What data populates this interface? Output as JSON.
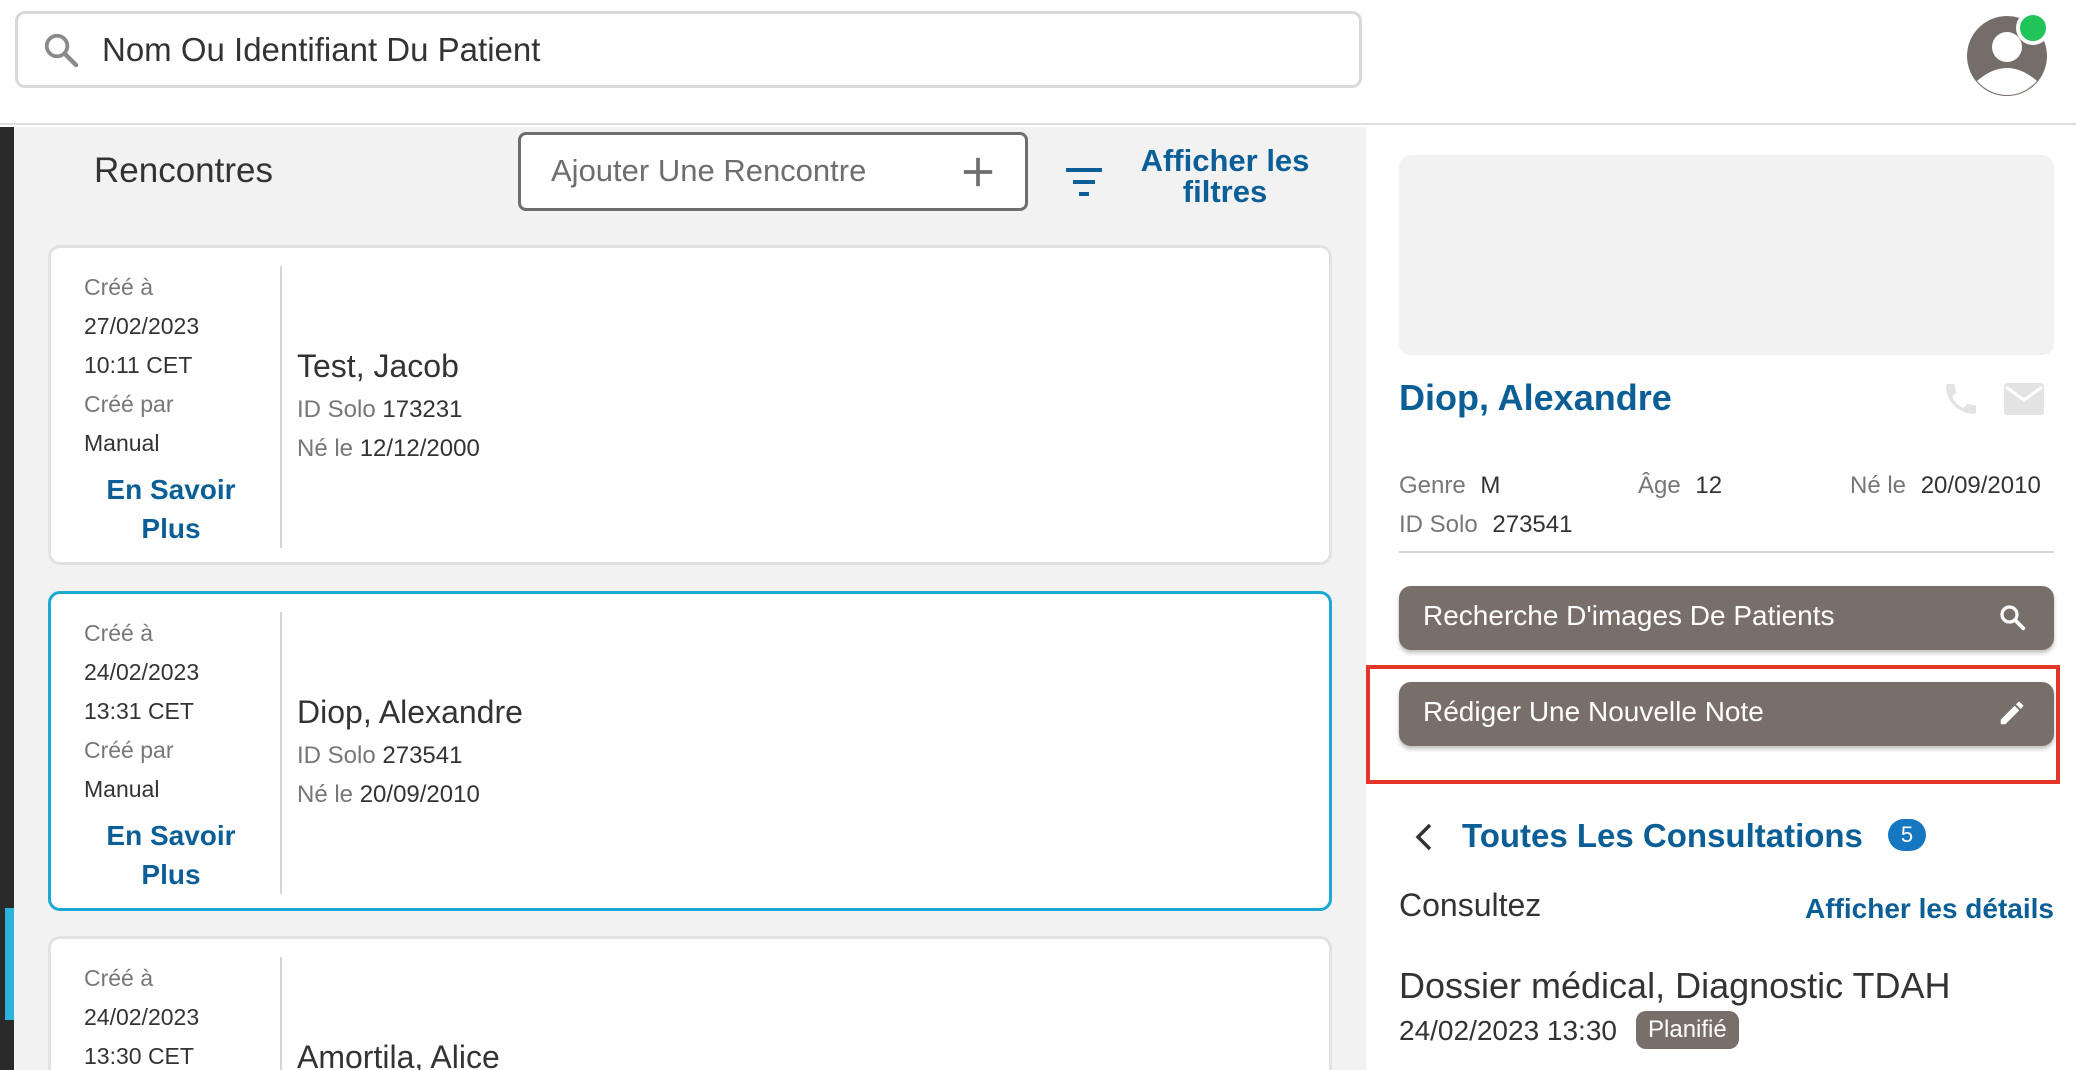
{
  "search": {
    "placeholder": "Nom Ou Identifiant Du Patient"
  },
  "user": {
    "avatar_icon": "user-avatar-icon",
    "status_color": "#21c45a"
  },
  "encounters": {
    "title": "Rencontres",
    "add_label": "Ajouter Une Rencontre",
    "filters_line1": "Afficher les",
    "filters_line2": "filtres",
    "list": [
      {
        "created_at_label": "Créé à",
        "date": "27/02/2023",
        "time": "10:11 CET",
        "created_by_label": "Créé par",
        "created_by": "Manual",
        "more_line1": "En Savoir",
        "more_line2": "Plus",
        "patient_name": "Test, Jacob",
        "id_label": "ID Solo",
        "id": "173231",
        "dob_label": "Né le",
        "dob": "12/12/2000",
        "selected": false
      },
      {
        "created_at_label": "Créé à",
        "date": "24/02/2023",
        "time": "13:31 CET",
        "created_by_label": "Créé par",
        "created_by": "Manual",
        "more_line1": "En Savoir",
        "more_line2": "Plus",
        "patient_name": "Diop, Alexandre",
        "id_label": "ID Solo",
        "id": "273541",
        "dob_label": "Né le",
        "dob": "20/09/2010",
        "selected": true
      },
      {
        "created_at_label": "Créé à",
        "date": "24/02/2023",
        "time": "13:30 CET",
        "patient_name": "Amortila, Alice",
        "selected": false
      }
    ]
  },
  "patient": {
    "name": "Diop, Alexandre",
    "gender_label": "Genre",
    "gender": "M",
    "age_label": "Âge",
    "age": "12",
    "dob_label": "Né le",
    "dob": "20/09/2010",
    "id_label": "ID Solo",
    "id": "273541"
  },
  "actions": {
    "image_search": "Recherche D'images De Patients",
    "new_note": "Rédiger Une Nouvelle Note"
  },
  "consultations": {
    "title": "Toutes Les Consultations",
    "count": "5",
    "subtitle": "Consultez",
    "details_link": "Afficher les détails",
    "visit_title": "Dossier médical, Diagnostic TDAH",
    "visit_date": "24/02/2023 13:30",
    "visit_status": "Planifié"
  },
  "colors": {
    "brand_blue": "#0c5f96",
    "selected_border": "#1aa9d2",
    "action_bg": "#786f6b",
    "highlight": "#e4352b",
    "badge": "#1577c0"
  }
}
